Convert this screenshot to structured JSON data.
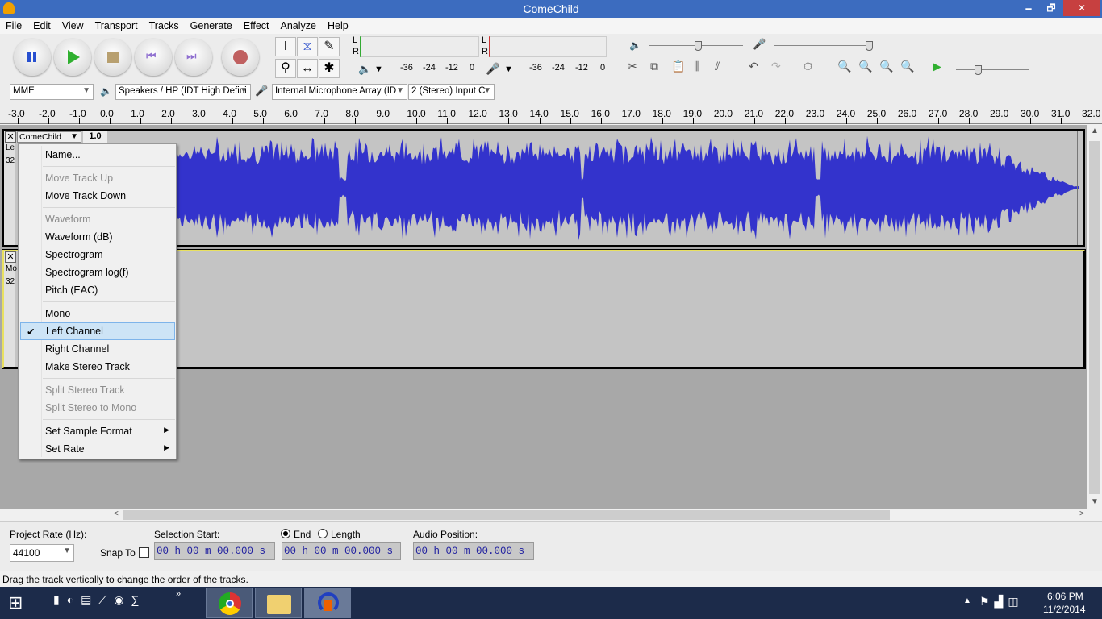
{
  "window": {
    "title": "ComeChild",
    "min": "🗕",
    "max": "🗗",
    "close": "✕"
  },
  "menu": [
    "File",
    "Edit",
    "View",
    "Transport",
    "Tracks",
    "Generate",
    "Effect",
    "Analyze",
    "Help"
  ],
  "meters": {
    "l": "L",
    "r": "R",
    "ticks": [
      "-36",
      "-24",
      "-12",
      "0"
    ]
  },
  "devices": {
    "host": "MME",
    "output": "Speakers / HP (IDT High Defini",
    "input": "Internal Microphone Array (ID",
    "channels": "2 (Stereo) Input C"
  },
  "ruler": [
    "-3.0",
    "-2.0",
    "-1.0",
    "0.0",
    "1.0",
    "2.0",
    "3.0",
    "4.0",
    "5.0",
    "6.0",
    "7.0",
    "8.0",
    "9.0",
    "10.0",
    "11.0",
    "12.0",
    "13.0",
    "14.0",
    "15.0",
    "16.0",
    "17.0",
    "18.0",
    "19.0",
    "20.0",
    "21.0",
    "22.0",
    "23.0",
    "24.0",
    "25.0",
    "26.0",
    "27.0",
    "28.0",
    "29.0",
    "30.0",
    "31.0",
    "32.0"
  ],
  "track1": {
    "name": "ComeChild",
    "scale": "1.0",
    "info1": "Le",
    "info2": "32",
    "close": "✕"
  },
  "track2": {
    "info1": "Mo",
    "info2": "32",
    "close": "✕"
  },
  "colors": {
    "waveform": "#3333cc",
    "titlebar": "#3c6cbf",
    "selected_track": "#e8e060"
  },
  "track_menu": {
    "items": [
      {
        "label": "Name...",
        "disabled": false
      },
      {
        "label": "Move Track Up",
        "disabled": true
      },
      {
        "label": "Move Track Down",
        "disabled": false
      },
      {
        "label": "Waveform",
        "disabled": true
      },
      {
        "label": "Waveform (dB)",
        "disabled": false
      },
      {
        "label": "Spectrogram",
        "disabled": false
      },
      {
        "label": "Spectrogram log(f)",
        "disabled": false
      },
      {
        "label": "Pitch (EAC)",
        "disabled": false
      },
      {
        "label": "Mono",
        "disabled": false
      },
      {
        "label": "Left Channel",
        "disabled": false,
        "checked": true
      },
      {
        "label": "Right Channel",
        "disabled": false
      },
      {
        "label": "Make Stereo Track",
        "disabled": false
      },
      {
        "label": "Split Stereo Track",
        "disabled": true
      },
      {
        "label": "Split Stereo to Mono",
        "disabled": true
      },
      {
        "label": "Set Sample Format",
        "disabled": false,
        "submenu": true
      },
      {
        "label": "Set Rate",
        "disabled": false,
        "submenu": true
      }
    ]
  },
  "selection": {
    "rate_label": "Project Rate (Hz):",
    "rate": "44100",
    "snap": "Snap To",
    "start_label": "Selection Start:",
    "end": "End",
    "length": "Length",
    "audio_pos": "Audio Position:",
    "start": "00 h 00 m 00.000 s",
    "endval": "00 h 00 m 00.000 s",
    "pos": "00 h 00 m 00.000 s"
  },
  "status": "Drag the track vertically to change the order of the tracks.",
  "taskbar": {
    "time": "6:06 PM",
    "date": "11/2/2014"
  }
}
